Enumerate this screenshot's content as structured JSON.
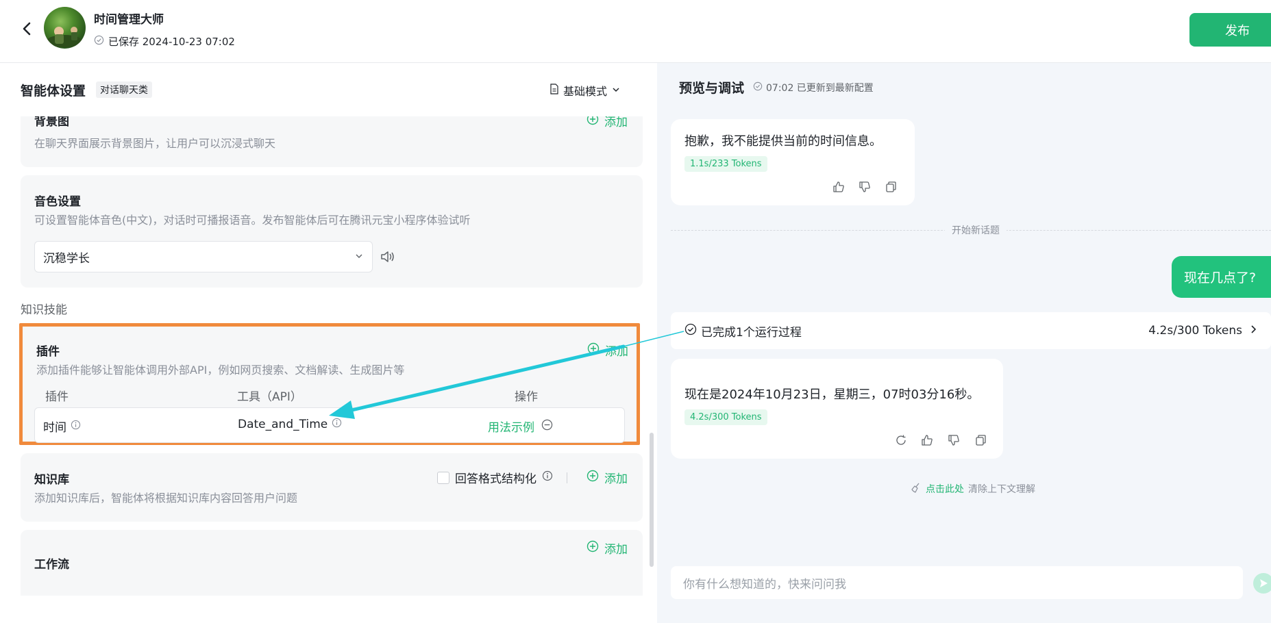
{
  "header": {
    "title": "时间管理大师",
    "save_status": "已保存 2024-10-23 07:02",
    "publish_label": "发布"
  },
  "left": {
    "title": "智能体设置",
    "tag": "对话聊天类",
    "mode": "基础模式",
    "background_card": {
      "title": "背景图",
      "desc": "在聊天界面展示背景图片，让用户可以沉浸式聊天",
      "add_label": "添加"
    },
    "voice_card": {
      "title": "音色设置",
      "desc": "可设置智能体音色(中文)，对话时可播报语音。发布智能体后可在腾讯元宝小程序体验试听",
      "selected_voice": "沉稳学长"
    },
    "skills_label": "知识技能",
    "plugin_card": {
      "title": "插件",
      "desc": "添加插件能够让智能体调用外部API，例如网页搜索、文档解读、生成图片等",
      "add_label": "添加",
      "columns": [
        "插件",
        "工具（API）",
        "操作"
      ],
      "rows": [
        {
          "plugin": "时间",
          "tool": "Date_and_Time",
          "action": "用法示例"
        }
      ]
    },
    "kb_card": {
      "title": "知识库",
      "desc": "添加知识库后，智能体将根据知识库内容回答用户问题",
      "structured_label": "回答格式结构化",
      "add_label": "添加"
    },
    "workflow_card": {
      "title": "工作流",
      "add_label": "添加"
    }
  },
  "right": {
    "title": "预览与调试",
    "status": "07:02 已更新到最新配置",
    "msg1": {
      "text": "抱歉，我不能提供当前的时间信息。",
      "tokens": "1.1s/233 Tokens"
    },
    "divider": "开始新话题",
    "user_msg": "现在几点了?",
    "process": {
      "label": "已完成1个运行过程",
      "stats": "4.2s/300 Tokens"
    },
    "msg2": {
      "text": "现在是2024年10月23日，星期三，07时03分16秒。",
      "tokens": "4.2s/300 Tokens"
    },
    "clear_link": "点击此处",
    "clear_text": "清除上下文理解",
    "input_placeholder": "你有什么想知道的，快来问问我"
  },
  "colors": {
    "accent": "#22b573",
    "highlight_border": "#f08a3c",
    "arrow": "#22c8d8"
  }
}
